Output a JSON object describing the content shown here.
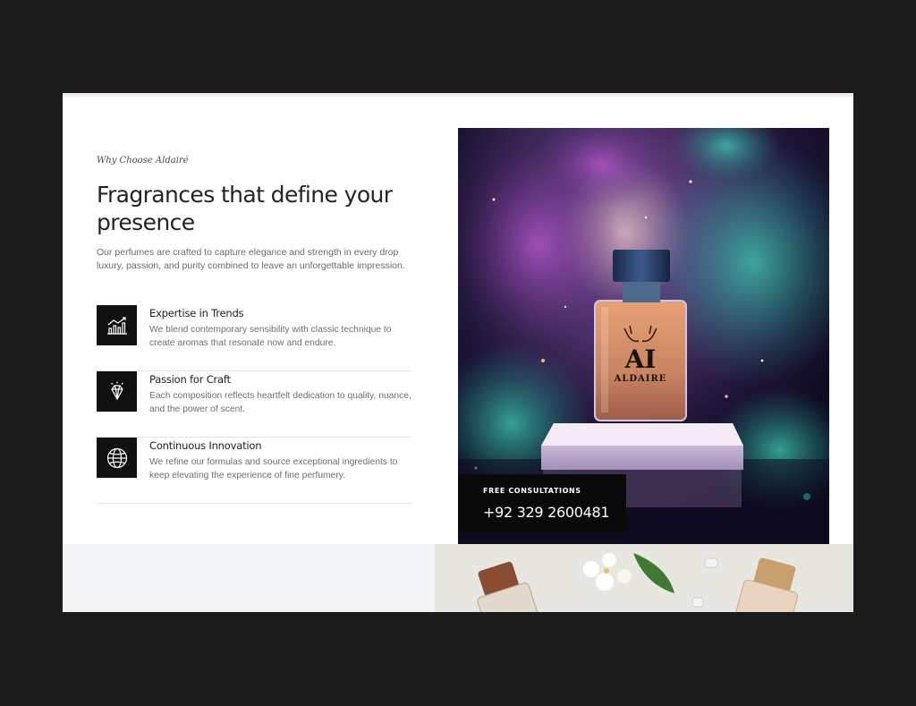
{
  "section": {
    "eyebrow": "Why Choose Aldairé",
    "heading": "Fragrances that define your presence",
    "intro": "Our perfumes are crafted to capture elegance and strength in every drop luxury, passion, and purity combined to leave an unforgettable impression."
  },
  "features": [
    {
      "icon": "chart-growth-icon",
      "title": "Expertise in Trends",
      "description": "We blend contemporary sensibility with classic technique to create aromas that resonate now and endure."
    },
    {
      "icon": "diamond-icon",
      "title": "Passion for Craft",
      "description": "Each composition reflects heartfelt dedication to quality, nuance, and the power of scent."
    },
    {
      "icon": "globe-icon",
      "title": "Continuous Innovation",
      "description": "We refine our formulas and source exceptional ingredients to keep elevating the experience of fine perfumery."
    }
  ],
  "hero": {
    "brand_monogram": "AI",
    "brand_name": "ALDAIRE"
  },
  "contact": {
    "label": "FREE CONSULTATIONS",
    "phone": "+92 329 2600481"
  },
  "colors": {
    "page_background": "#1b1b1b",
    "card_background": "#ffffff",
    "icon_tile": "#111111",
    "contact_box": "#090909"
  }
}
